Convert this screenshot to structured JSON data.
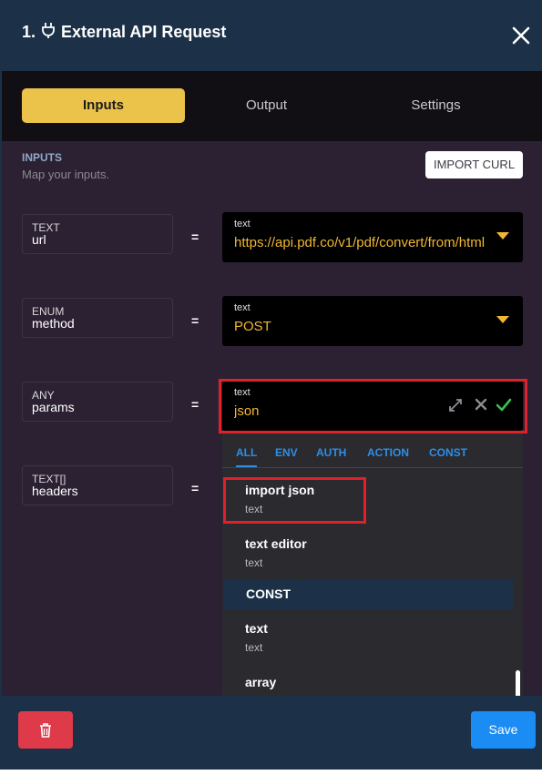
{
  "header": {
    "step": "1.",
    "title": "External API Request"
  },
  "tabs": [
    {
      "label": "Inputs",
      "active": true
    },
    {
      "label": "Output",
      "active": false
    },
    {
      "label": "Settings",
      "active": false
    }
  ],
  "inputs_section": {
    "label": "INPUTS",
    "subtitle": "Map your inputs.",
    "import_curl_label": "IMPORT CURL"
  },
  "rows": [
    {
      "type": "TEXT",
      "name": "url",
      "value_type": "text",
      "value": "https://api.pdf.co/v1/pdf/convert/from/html"
    },
    {
      "type": "ENUM",
      "name": "method",
      "value_type": "text",
      "value": "POST"
    },
    {
      "type": "ANY",
      "name": "params",
      "value_type": "text",
      "value": "json"
    },
    {
      "type": "TEXT[]",
      "name": "headers"
    }
  ],
  "equals": "=",
  "dropdown": {
    "tabs": [
      "ALL",
      "ENV",
      "AUTH",
      "ACTION",
      "CONST"
    ],
    "items": [
      {
        "title": "import json",
        "subtitle": "text"
      },
      {
        "title": "text editor",
        "subtitle": "text"
      }
    ],
    "group_label": "CONST",
    "const_items": [
      {
        "title": "text",
        "subtitle": "text"
      },
      {
        "title": "array",
        "subtitle": ""
      }
    ]
  },
  "footer": {
    "save_label": "Save"
  },
  "colors": {
    "accent": "#ebc34a",
    "value": "#f1b733",
    "link": "#2f8ee6",
    "highlight": "#e0202a",
    "save": "#1b8cf3",
    "delete": "#df3a49",
    "confirm": "#3fbf4f"
  }
}
